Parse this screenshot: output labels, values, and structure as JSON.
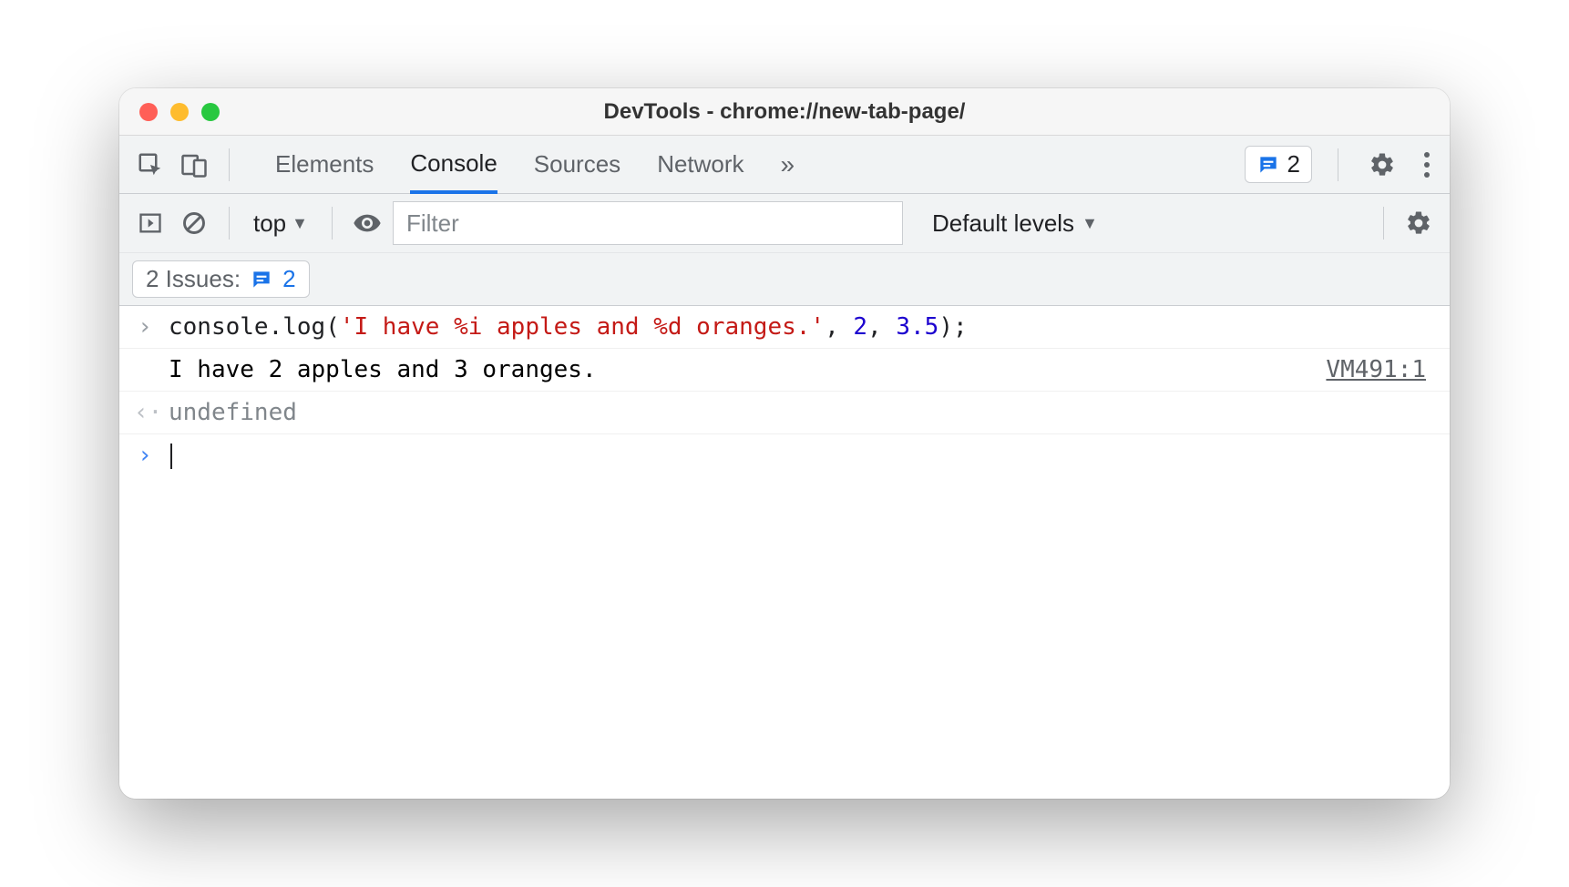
{
  "window": {
    "title": "DevTools - chrome://new-tab-page/"
  },
  "tabs": {
    "items": [
      "Elements",
      "Console",
      "Sources",
      "Network"
    ],
    "active": "Console",
    "overflow_glyph": "»"
  },
  "issues_pill": {
    "count": "2"
  },
  "toolbar": {
    "context": "top",
    "filter_placeholder": "Filter",
    "levels_label": "Default levels",
    "issues_label": "2 Issues:",
    "issues_count": "2"
  },
  "console": {
    "input_line": {
      "method": "console.log",
      "open": "(",
      "string": "'I have %i apples and %d oranges.'",
      "comma1": ",",
      "arg1": "2",
      "comma2": ",",
      "arg2": "3.5",
      "close": ");"
    },
    "output_text": "I have 2 apples and 3 oranges.",
    "output_source": "VM491:1",
    "return_value": "undefined"
  }
}
